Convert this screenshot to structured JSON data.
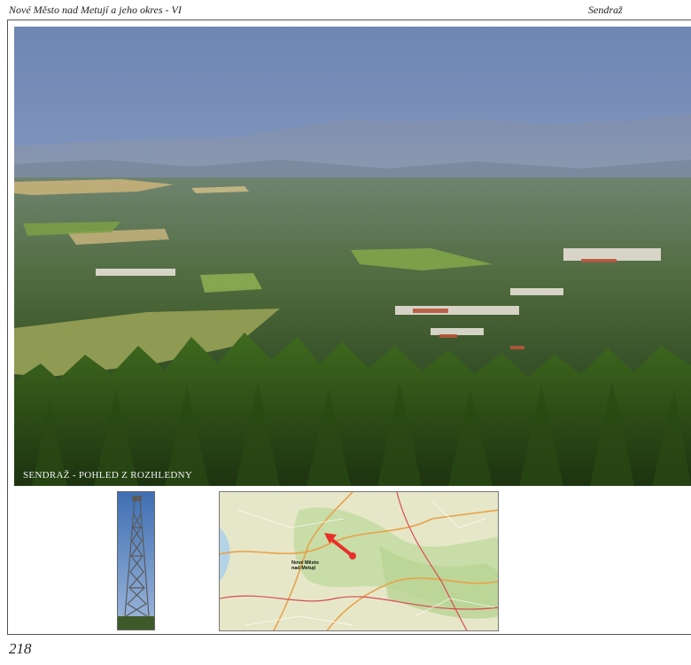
{
  "header": {
    "left_title": "Nové Město nad Metují a jeho okres - VI",
    "right_title": "Sendraž"
  },
  "main_photo": {
    "caption": "SENDRAŽ - POHLED Z ROZHLEDNY"
  },
  "map": {
    "town_label_line1": "Nové Město",
    "town_label_line2": "nad Metují",
    "marker_color": "#e8302a"
  },
  "page_number": "218"
}
